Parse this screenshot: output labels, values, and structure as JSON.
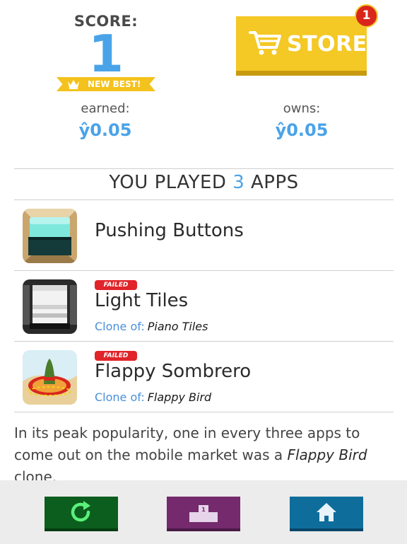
{
  "score": {
    "label": "SCORE:",
    "value": "1",
    "new_best": "NEW BEST!"
  },
  "earned": {
    "label": "earned:",
    "value": "ŷ0.05"
  },
  "owns": {
    "label": "owns:",
    "value": "ŷ0.05"
  },
  "store": {
    "label": "STORE",
    "badge": "1"
  },
  "played": {
    "prefix": "YOU PLAYED",
    "count": "3",
    "suffix": "APPS"
  },
  "apps": [
    {
      "name": "Pushing Buttons",
      "failed": "",
      "clone_label": "",
      "clone_of": "",
      "icon": "pushing-buttons-icon"
    },
    {
      "name": "Light Tiles",
      "failed": "FAILED",
      "clone_label": "Clone of:",
      "clone_of": "Piano Tiles",
      "icon": "light-tiles-icon"
    },
    {
      "name": "Flappy Sombrero",
      "failed": "FAILED",
      "clone_label": "Clone of:",
      "clone_of": "Flappy Bird",
      "icon": "sombrero-icon"
    }
  ],
  "fact": {
    "text_before": "In its peak popularity, one in every three apps to come out on the mobile market was a ",
    "highlight": "Flappy Bird",
    "text_after": " clone."
  },
  "buttons": {
    "replay_icon": "replay-icon",
    "leaderboard_icon": "podium-icon",
    "leaderboard_rank": "1",
    "home_icon": "home-icon"
  },
  "colors": {
    "accent_blue": "#4aa3e8",
    "store_yellow": "#f4c825",
    "badge_red": "#d9261c",
    "failed_red": "#e0242a",
    "replay_green": "#0b5e1e",
    "ranks_purple": "#742a6c",
    "home_blue": "#0f6d9c"
  }
}
